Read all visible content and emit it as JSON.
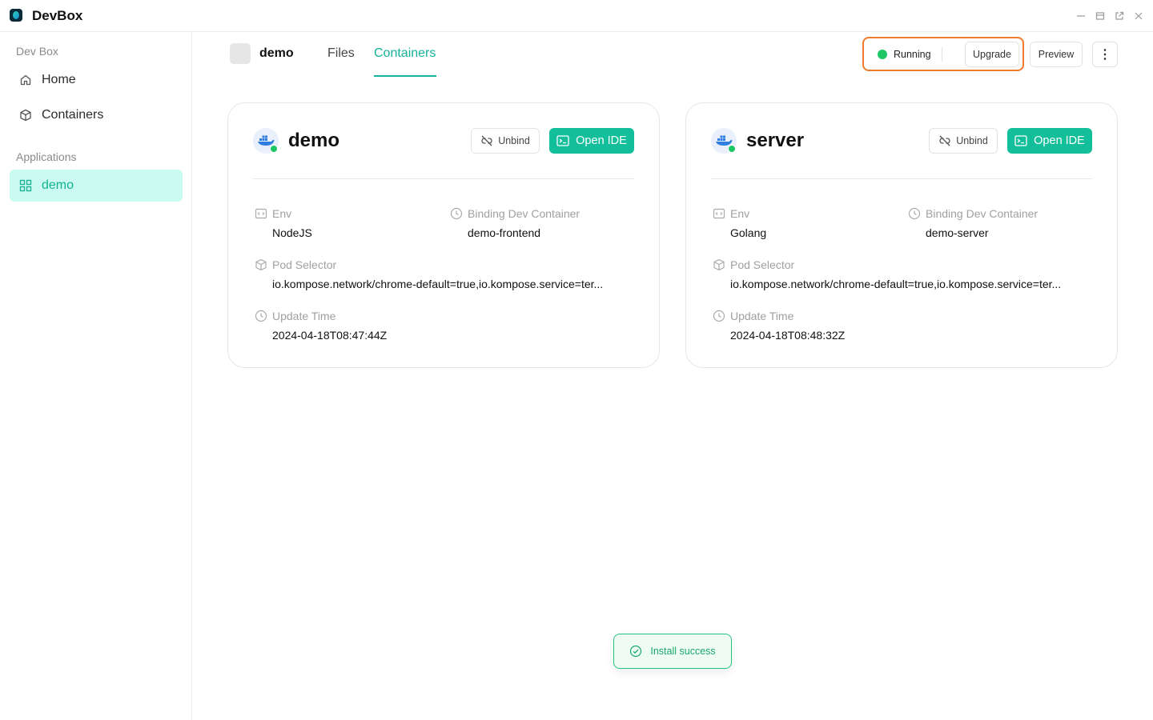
{
  "window": {
    "title": "DevBox",
    "controls": [
      "minimize-icon",
      "restore-icon",
      "popout-icon",
      "close-icon"
    ]
  },
  "sidebar": {
    "section1": "Dev Box",
    "items": [
      {
        "label": "Home",
        "icon": "home-icon"
      },
      {
        "label": "Containers",
        "icon": "box-icon"
      }
    ],
    "section2": "Applications",
    "apps": [
      {
        "label": "demo",
        "icon": "grid-icon",
        "active": true
      }
    ]
  },
  "header": {
    "app_name": "demo",
    "tabs": [
      {
        "label": "Files",
        "active": false
      },
      {
        "label": "Containers",
        "active": true
      }
    ],
    "status": "Running",
    "upgrade_label": "Upgrade",
    "preview_label": "Preview",
    "more_label": "⋮"
  },
  "cards": [
    {
      "name": "demo",
      "unbind_label": "Unbind",
      "open_label": "Open IDE",
      "env_label": "Env",
      "env": "NodeJS",
      "binding_label": "Binding Dev Container",
      "binding": "demo-frontend",
      "selector_label": "Pod Selector",
      "selector": "io.kompose.network/chrome-default=true,io.kompose.service=ter...",
      "update_label": "Update Time",
      "update": "2024-04-18T08:47:44Z"
    },
    {
      "name": "server",
      "unbind_label": "Unbind",
      "open_label": "Open IDE",
      "env_label": "Env",
      "env": "Golang",
      "binding_label": "Binding Dev Container",
      "binding": "demo-server",
      "selector_label": "Pod Selector",
      "selector": "io.kompose.network/chrome-default=true,io.kompose.service=ter...",
      "update_label": "Update Time",
      "update": "2024-04-18T08:48:32Z"
    }
  ],
  "toast": {
    "message": "Install success",
    "icon": "check-circle-icon"
  },
  "colors": {
    "accent": "#15b29a",
    "primary_button": "#13bf9b",
    "running": "#1ec764",
    "highlight_border": "#f07a2e",
    "active_nav_bg": "#cbfaf2"
  }
}
